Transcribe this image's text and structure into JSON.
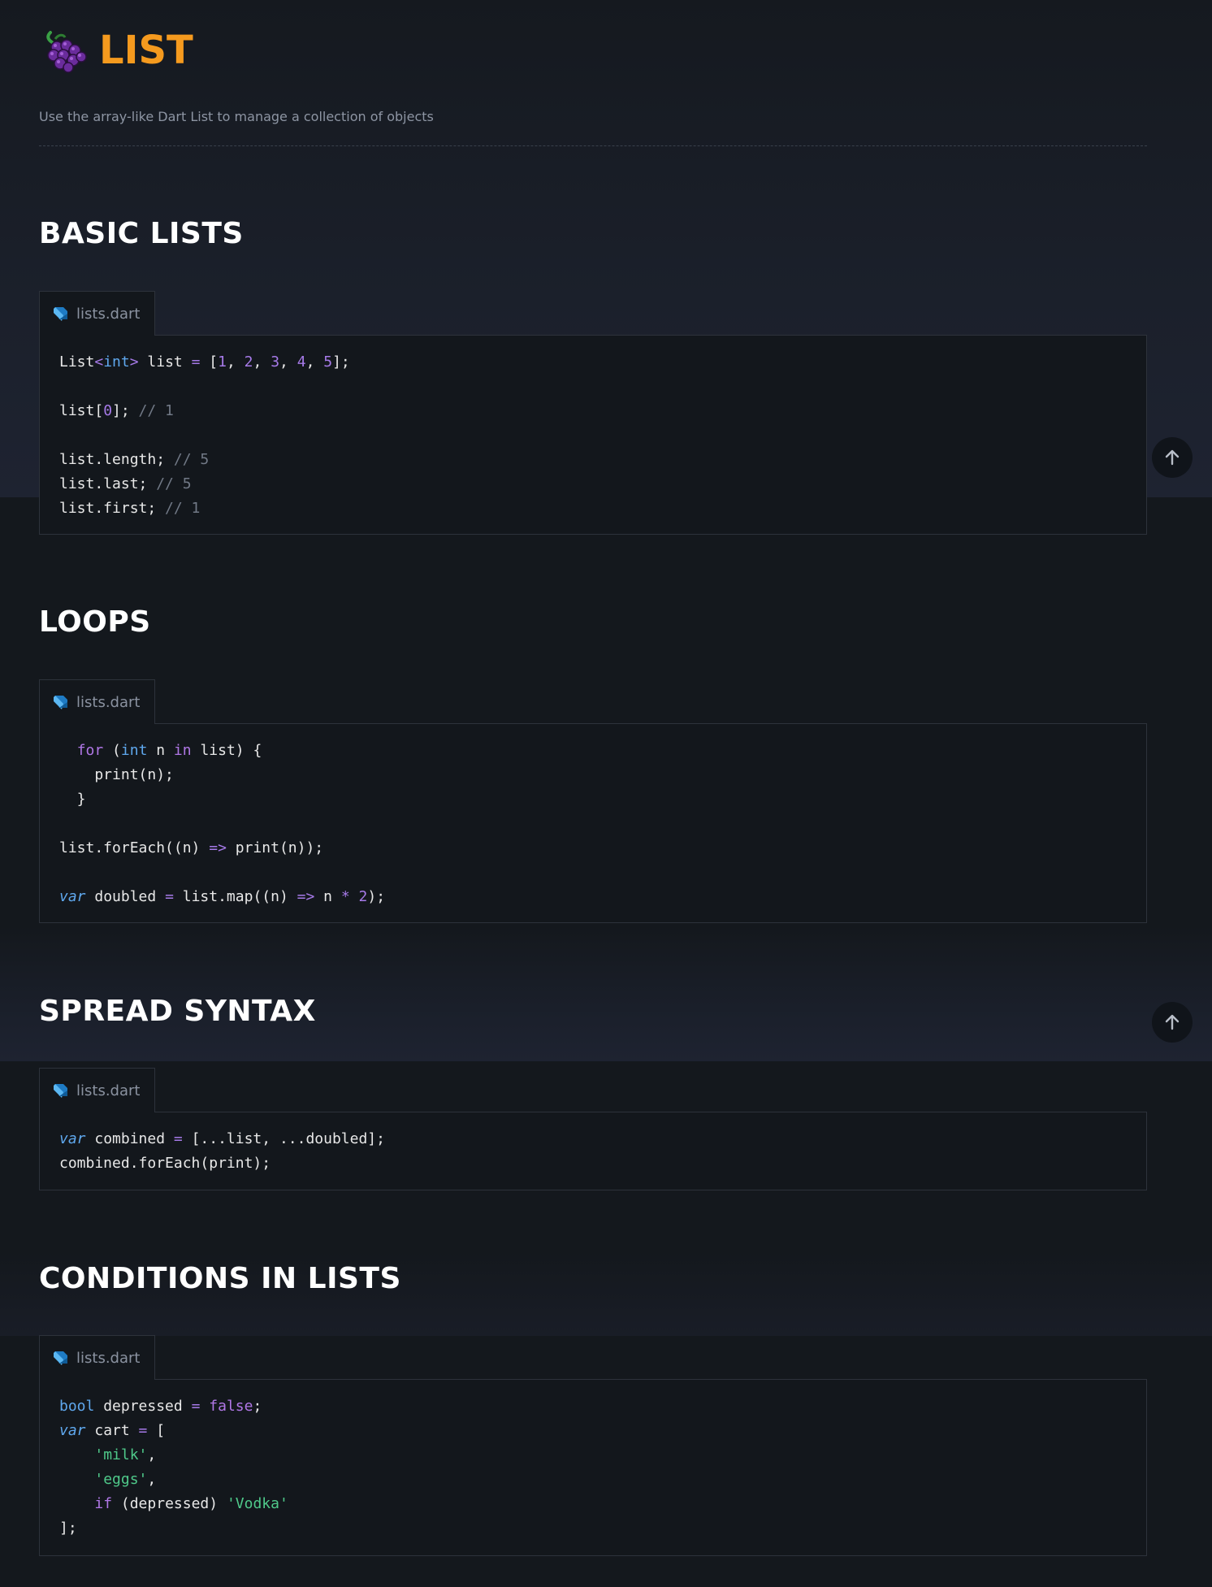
{
  "header": {
    "title": "LIST",
    "subtitle": "Use the array-like Dart List to manage a collection of objects"
  },
  "sections": [
    {
      "heading": "BASIC LISTS",
      "file": "lists.dart"
    },
    {
      "heading": "LOOPS",
      "file": "lists.dart"
    },
    {
      "heading": "SPREAD SYNTAX",
      "file": "lists.dart"
    },
    {
      "heading": "CONDITIONS IN LISTS",
      "file": "lists.dart"
    }
  ],
  "code": {
    "basic": [
      [
        [
          "List",
          ""
        ],
        [
          "<",
          "op"
        ],
        [
          "int",
          "ty"
        ],
        [
          ">",
          "op"
        ],
        [
          " list ",
          ""
        ],
        [
          "=",
          "op"
        ],
        [
          " [",
          ""
        ],
        [
          "1",
          "num"
        ],
        [
          ", ",
          ""
        ],
        [
          "2",
          "num"
        ],
        [
          ", ",
          ""
        ],
        [
          "3",
          "num"
        ],
        [
          ", ",
          ""
        ],
        [
          "4",
          "num"
        ],
        [
          ", ",
          ""
        ],
        [
          "5",
          "num"
        ],
        [
          "];",
          ""
        ]
      ],
      [],
      [
        [
          "list[",
          ""
        ],
        [
          "0",
          "num"
        ],
        [
          "]; ",
          ""
        ],
        [
          "// 1",
          "cm"
        ]
      ],
      [],
      [
        [
          "list.length; ",
          ""
        ],
        [
          "// 5",
          "cm"
        ]
      ],
      [
        [
          "list.last; ",
          ""
        ],
        [
          "// 5",
          "cm"
        ]
      ],
      [
        [
          "list.first; ",
          ""
        ],
        [
          "// 1",
          "cm"
        ]
      ]
    ],
    "loops": [
      [
        [
          "  ",
          ""
        ],
        [
          "for",
          "kw"
        ],
        [
          " (",
          ""
        ],
        [
          "int",
          "ty"
        ],
        [
          " n ",
          ""
        ],
        [
          "in",
          "kw"
        ],
        [
          " list) {",
          ""
        ]
      ],
      [
        [
          "    print(n);",
          ""
        ]
      ],
      [
        [
          "  }",
          ""
        ]
      ],
      [],
      [
        [
          "list.forEach((n) ",
          ""
        ],
        [
          "=>",
          "op"
        ],
        [
          " print(n));",
          ""
        ]
      ],
      [],
      [
        [
          "var",
          "var"
        ],
        [
          " doubled ",
          ""
        ],
        [
          "=",
          "op"
        ],
        [
          " list.map((n) ",
          ""
        ],
        [
          "=>",
          "op"
        ],
        [
          " n ",
          ""
        ],
        [
          "*",
          "op"
        ],
        [
          " ",
          ""
        ],
        [
          "2",
          "num"
        ],
        [
          ");",
          ""
        ]
      ]
    ],
    "spread": [
      [
        [
          "var",
          "var"
        ],
        [
          " combined ",
          ""
        ],
        [
          "=",
          "op"
        ],
        [
          " [...list, ...doubled];",
          ""
        ]
      ],
      [
        [
          "combined.forEach(print);",
          ""
        ]
      ]
    ],
    "conditions": [
      [
        [
          "bool",
          "ty"
        ],
        [
          " depressed ",
          ""
        ],
        [
          "=",
          "op"
        ],
        [
          " ",
          ""
        ],
        [
          "false",
          "kw"
        ],
        [
          ";",
          ""
        ]
      ],
      [
        [
          "var",
          "var"
        ],
        [
          " cart ",
          ""
        ],
        [
          "=",
          "op"
        ],
        [
          " [",
          ""
        ]
      ],
      [
        [
          "    ",
          ""
        ],
        [
          "'milk'",
          "str"
        ],
        [
          ",",
          ""
        ]
      ],
      [
        [
          "    ",
          ""
        ],
        [
          "'eggs'",
          "str"
        ],
        [
          ",",
          ""
        ]
      ],
      [
        [
          "    ",
          ""
        ],
        [
          "if",
          "kw"
        ],
        [
          " (depressed) ",
          ""
        ],
        [
          "'Vodka'",
          "str"
        ]
      ],
      [
        [
          "];",
          ""
        ]
      ]
    ]
  }
}
